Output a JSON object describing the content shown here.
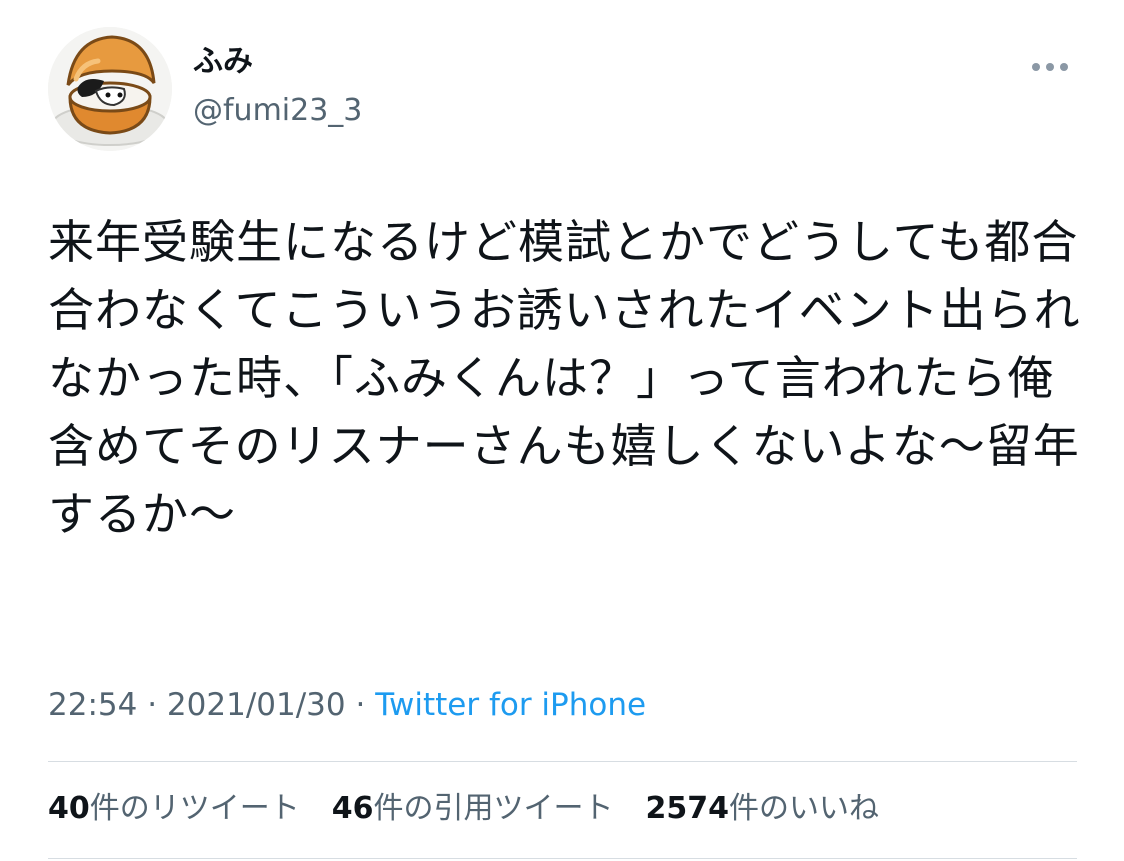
{
  "user": {
    "display_name": "ふみ",
    "handle": "@fumi23_3"
  },
  "tweet": {
    "text": "来年受験生になるけど模試とかでどうしても都合合わなくてこういうお誘いされたイベント出られなかった時、「ふみくんは？」って言われたら俺含めてそのリスナーさんも嬉しくないよな〜留年するか〜",
    "time": "22:54",
    "separator": "·",
    "date": "2021/01/30",
    "source": "Twitter for iPhone"
  },
  "stats": {
    "retweets": {
      "count": "40",
      "label": "件のリツイート"
    },
    "quotes": {
      "count": "46",
      "label": "件の引用ツイート"
    },
    "likes": {
      "count": "2574",
      "label": "件のいいね"
    }
  },
  "icons": {
    "more": "more-horizontal-icon"
  },
  "colors": {
    "text": "#0f1419",
    "secondary": "#536471",
    "link": "#1d9bf0",
    "divider": "#d7dde2"
  }
}
